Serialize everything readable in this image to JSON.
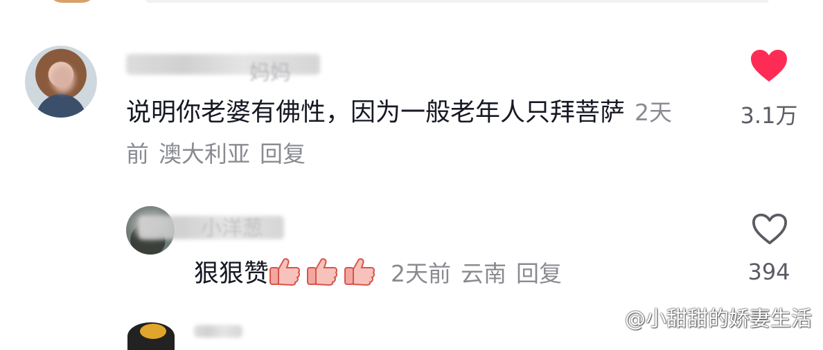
{
  "comment_1": {
    "username_visible": "妈妈",
    "text": "说明你老婆有佛性，因为一般老年人只拜菩萨",
    "time": "2天前",
    "location": "澳大利亚",
    "reply_label": "回复",
    "like_count": "3.1万",
    "liked": true,
    "like_color": "#fe2c55"
  },
  "comment_2": {
    "username_visible": "小洋葱",
    "text": "狠狠赞",
    "emoji_count": 3,
    "time": "2天前",
    "location": "云南",
    "reply_label": "回复",
    "like_count": "394",
    "liked": false
  },
  "watermark": {
    "text": "@小甜甜的娇妻生活",
    "icon": "weibo-icon"
  }
}
